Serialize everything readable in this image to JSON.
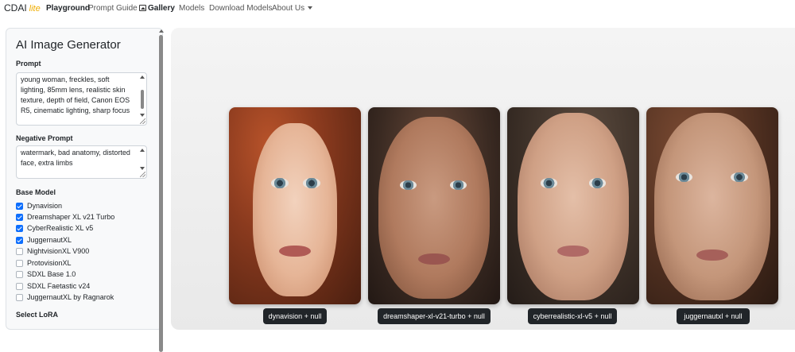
{
  "nav": {
    "brand": "CDAI",
    "brand_suffix": "lite",
    "links": [
      "Playground",
      "Prompt Guide",
      "Gallery",
      "Models",
      "Download Models",
      "About Us"
    ]
  },
  "sidebar": {
    "title": "AI Image Generator",
    "prompt_label": "Prompt",
    "prompt_value": "young woman, freckles, soft lighting, 85mm lens, realistic skin texture, depth of field, Canon EOS R5, cinematic lighting, sharp focus",
    "negative_label": "Negative Prompt",
    "negative_value": "watermark, bad anatomy, distorted face, extra limbs",
    "base_model_label": "Base Model",
    "models": [
      {
        "name": "Dynavision",
        "checked": true
      },
      {
        "name": "Dreamshaper XL v21 Turbo",
        "checked": true
      },
      {
        "name": "CyberRealistic XL v5",
        "checked": true
      },
      {
        "name": "JuggernautXL",
        "checked": true
      },
      {
        "name": "NightvisionXL V900",
        "checked": false
      },
      {
        "name": "ProtovisionXL",
        "checked": false
      },
      {
        "name": "SDXL Base 1.0",
        "checked": false
      },
      {
        "name": "SDXL Faetastic v24",
        "checked": false
      },
      {
        "name": "JuggernautXL by Ragnarok",
        "checked": false
      }
    ],
    "lora_label": "Select LoRA"
  },
  "gallery": {
    "images": [
      {
        "caption": "dynavision + null"
      },
      {
        "caption": "dreamshaper-xl-v21-turbo + null"
      },
      {
        "caption": "cyberrealistic-xl-v5 + null"
      },
      {
        "caption": "juggernautxl + null"
      }
    ]
  },
  "colors": {
    "accent": "#0d6efd",
    "brand_suffix": "#f0ad00",
    "caption_bg": "#212529"
  }
}
